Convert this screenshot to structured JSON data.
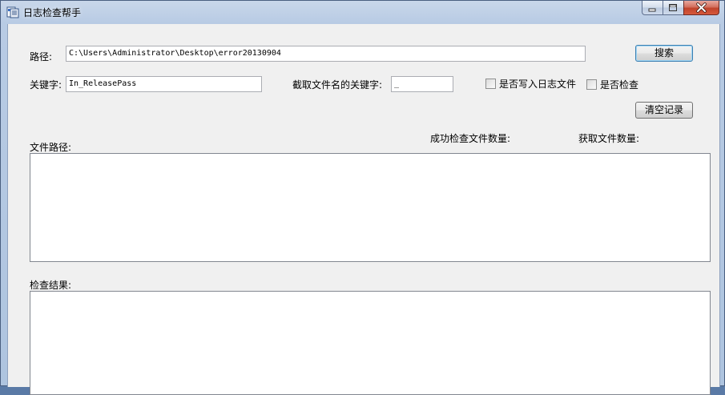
{
  "window": {
    "title": "日志检查帮手"
  },
  "form": {
    "path_label": "路径:",
    "path_value": "C:\\Users\\Administrator\\Desktop\\error20130904",
    "search_button": "搜索",
    "keyword_label": "关键字:",
    "keyword_value": "In_ReleasePass",
    "filename_keyword_label": "截取文件名的关键字:",
    "filename_keyword_value": "_",
    "write_log_checkbox_label": "是否写入日志文件",
    "check_checkbox_label": "是否检查",
    "clear_button": "清空记录",
    "success_count_label": "成功检查文件数量:",
    "file_count_label": "获取文件数量:",
    "file_path_label": "文件路径:",
    "result_label": "检查结果:"
  }
}
